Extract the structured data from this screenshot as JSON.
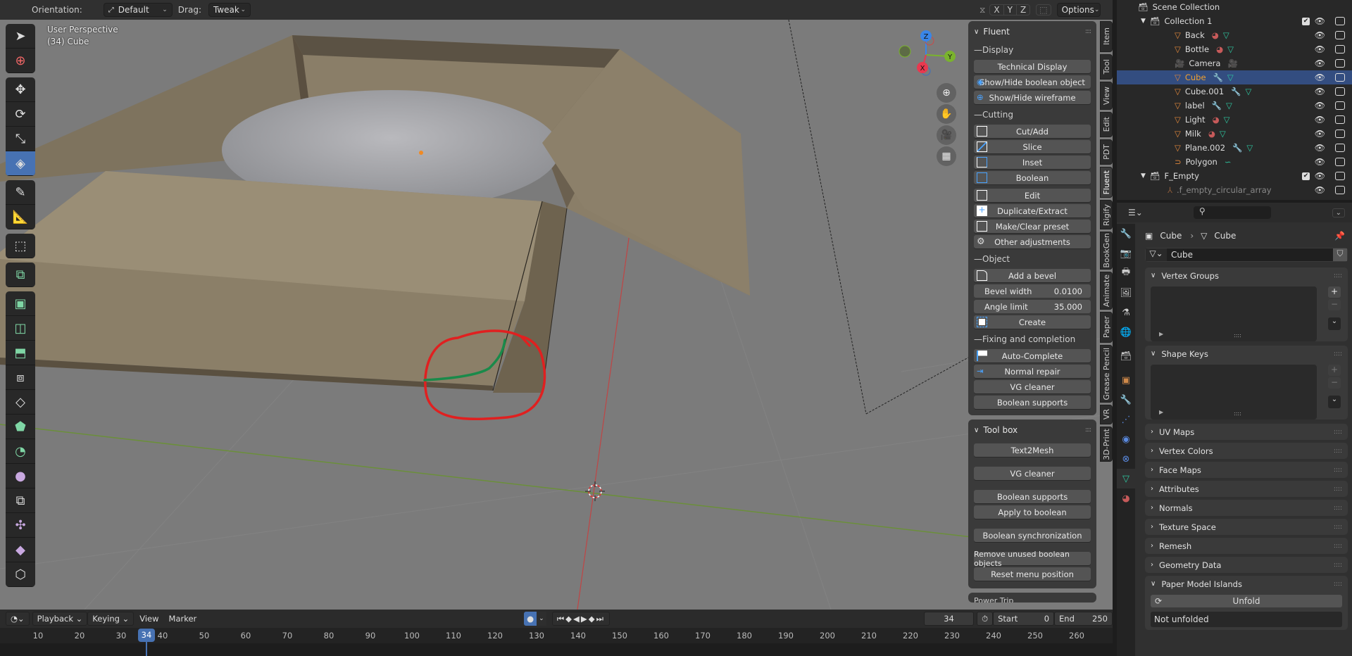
{
  "header": {
    "orientation_label": "Orientation:",
    "orientation_value": "Default",
    "drag_label": "Drag:",
    "drag_value": "Tweak",
    "axis_x": "X",
    "axis_y": "Y",
    "axis_z": "Z",
    "options_label": "Options"
  },
  "viewport": {
    "view_name": "User Perspective",
    "object_info": "(34) Cube",
    "gizmo": {
      "x": "X",
      "y": "Y",
      "z": "Z"
    },
    "annotation_colors": {
      "circle": "#e02020",
      "stroke": "#1a8a4a"
    }
  },
  "toolbar": {
    "tools": [
      {
        "name": "select-box",
        "icon": "cursor-arrow-icon"
      },
      {
        "name": "cursor",
        "icon": "3d-cursor-icon"
      },
      {
        "name": "move",
        "icon": "move-icon"
      },
      {
        "name": "rotate",
        "icon": "rotate-icon"
      },
      {
        "name": "scale",
        "icon": "scale-icon"
      },
      {
        "name": "transform",
        "icon": "transform-icon",
        "active": true
      },
      {
        "name": "annotate",
        "icon": "pencil-icon"
      },
      {
        "name": "measure",
        "icon": "ruler-icon"
      },
      {
        "name": "add-cube",
        "icon": "add-cube-icon"
      },
      {
        "name": "extrude",
        "icon": "extrude-icon"
      },
      {
        "name": "inset",
        "icon": "inset-icon"
      },
      {
        "name": "bevel",
        "icon": "bevel-icon"
      },
      {
        "name": "loop-cut",
        "icon": "loop-cut-icon"
      },
      {
        "name": "knife",
        "icon": "knife-icon"
      },
      {
        "name": "poly-build",
        "icon": "poly-build-icon"
      },
      {
        "name": "spin",
        "icon": "spin-icon"
      },
      {
        "name": "smooth",
        "icon": "smooth-icon"
      },
      {
        "name": "edge-slide",
        "icon": "edge-slide-icon"
      },
      {
        "name": "shrink-fatten",
        "icon": "shrink-fatten-icon"
      },
      {
        "name": "shear",
        "icon": "shear-icon"
      },
      {
        "name": "rip",
        "icon": "rip-icon"
      }
    ]
  },
  "npanel": {
    "fluent": {
      "title": "Fluent",
      "display_label": "Display",
      "technical_display": "Technical Display",
      "show_hide_boolean": "Show/Hide boolean object",
      "show_hide_wireframe": "Show/Hide wireframe",
      "cutting_label": "Cutting",
      "cut_add": "Cut/Add",
      "slice": "Slice",
      "inset": "Inset",
      "boolean": "Boolean",
      "edit": "Edit",
      "duplicate_extract": "Duplicate/Extract",
      "make_clear_preset": "Make/Clear preset",
      "other_adjustments": "Other adjustments",
      "object_label": "Object",
      "add_bevel": "Add a bevel",
      "bevel_width_label": "Bevel width",
      "bevel_width_value": "0.0100",
      "angle_limit_label": "Angle limit",
      "angle_limit_value": "35.000",
      "create": "Create",
      "fixing_label": "Fixing and completion",
      "auto_complete": "Auto-Complete",
      "normal_repair": "Normal repair",
      "vg_cleaner": "VG cleaner",
      "boolean_supports": "Boolean supports"
    },
    "toolbox": {
      "title": "Tool box",
      "text2mesh": "Text2Mesh",
      "vg_cleaner": "VG cleaner",
      "boolean_supports": "Boolean supports",
      "apply_to_boolean": "Apply to boolean",
      "boolean_sync": "Boolean synchronization",
      "remove_unused": "Remove unused boolean objects",
      "reset_menu": "Reset menu position",
      "next_panel_partial": "Power Trip"
    },
    "tabs": [
      "Item",
      "Tool",
      "View",
      "Edit",
      "PDT",
      "Fluent",
      "Rigify",
      "BookGen",
      "Animate",
      "Paper",
      "Grease Pencil",
      "VR",
      "3D-Print"
    ],
    "active_tab": "Fluent"
  },
  "outliner": {
    "scene_collection": "Scene Collection",
    "collection1": "Collection 1",
    "items": [
      {
        "name": "Back",
        "type": "mesh",
        "extras": [
          "material",
          "mesh-data"
        ]
      },
      {
        "name": "Bottle",
        "type": "mesh",
        "extras": [
          "material",
          "mesh-data"
        ]
      },
      {
        "name": "Camera",
        "type": "camera",
        "extras": [
          "camera-data"
        ]
      },
      {
        "name": "Cube",
        "type": "mesh",
        "extras": [
          "modifier",
          "mesh-data"
        ],
        "selected": true
      },
      {
        "name": "Cube.001",
        "type": "mesh",
        "extras": [
          "modifier",
          "mesh-data"
        ]
      },
      {
        "name": "label",
        "type": "mesh",
        "extras": [
          "modifier",
          "mesh-data"
        ]
      },
      {
        "name": "Light",
        "type": "mesh",
        "extras": [
          "material",
          "mesh-data"
        ]
      },
      {
        "name": "Milk",
        "type": "mesh",
        "extras": [
          "material",
          "mesh-data"
        ]
      },
      {
        "name": "Plane.002",
        "type": "mesh",
        "extras": [
          "modifier",
          "mesh-data"
        ]
      },
      {
        "name": "Polygon",
        "type": "curve",
        "extras": [
          "curve-data"
        ]
      }
    ],
    "f_empty": "F_Empty",
    "f_empty_child": ".f_empty_circular_array"
  },
  "properties": {
    "breadcrumb_object": "Cube",
    "breadcrumb_data": "Cube",
    "data_name_value": "Cube",
    "search_placeholder": "",
    "sections": [
      {
        "label": "Vertex Groups",
        "open": true
      },
      {
        "label": "Shape Keys",
        "open": true
      },
      {
        "label": "UV Maps",
        "open": false
      },
      {
        "label": "Vertex Colors",
        "open": false
      },
      {
        "label": "Face Maps",
        "open": false
      },
      {
        "label": "Attributes",
        "open": false
      },
      {
        "label": "Normals",
        "open": false
      },
      {
        "label": "Texture Space",
        "open": false
      },
      {
        "label": "Remesh",
        "open": false
      },
      {
        "label": "Geometry Data",
        "open": false
      },
      {
        "label": "Paper Model Islands",
        "open": true
      }
    ],
    "unfold_button": "Unfold",
    "unfold_status": "Not unfolded"
  },
  "timeline": {
    "menu_playback": "Playback",
    "menu_keying": "Keying",
    "menu_view": "View",
    "menu_marker": "Marker",
    "current_frame": "34",
    "start_label": "Start",
    "start_value": "0",
    "end_label": "End",
    "end_value": "250",
    "ticks": [
      "10",
      "20",
      "30",
      "40",
      "50",
      "60",
      "70",
      "80",
      "90",
      "100",
      "110",
      "120",
      "130",
      "140",
      "150",
      "160",
      "170",
      "180",
      "190",
      "200",
      "210",
      "220",
      "230",
      "240",
      "250",
      "260"
    ]
  }
}
